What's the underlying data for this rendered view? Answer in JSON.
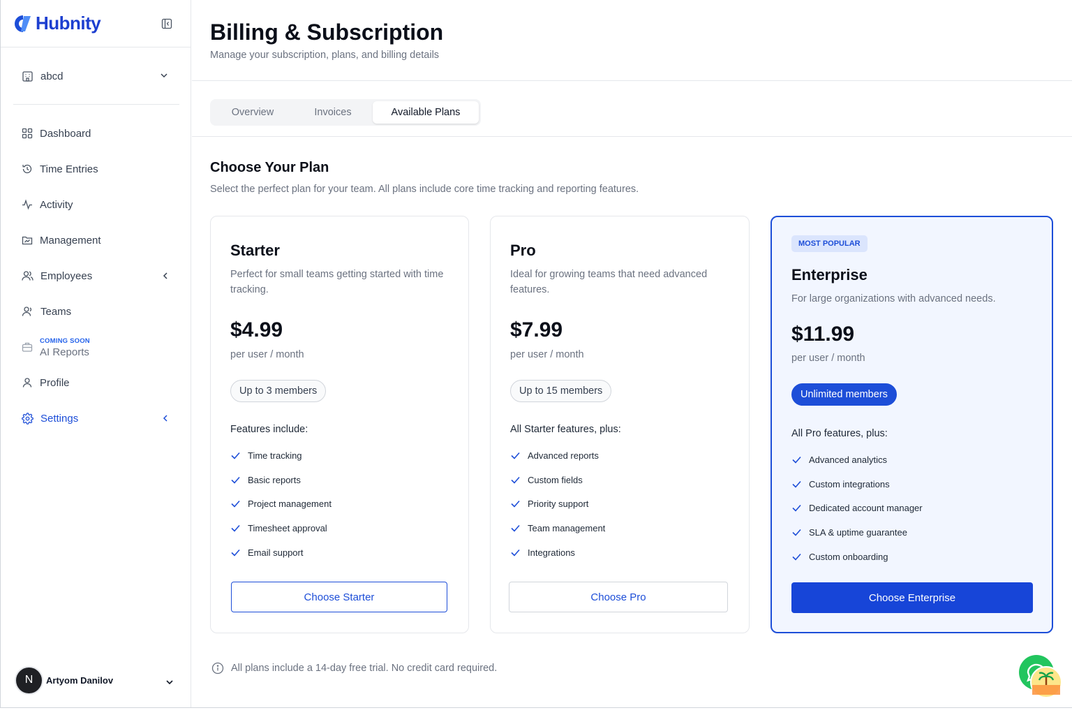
{
  "brand": {
    "name": "Hubnity",
    "accent": "#1d4ed8"
  },
  "sidebar": {
    "org": {
      "name": "abcd"
    },
    "items": [
      {
        "label": "Dashboard",
        "icon": "grid-icon"
      },
      {
        "label": "Time Entries",
        "icon": "history-icon"
      },
      {
        "label": "Activity",
        "icon": "activity-icon"
      },
      {
        "label": "Management",
        "icon": "folder-chart-icon"
      },
      {
        "label": "Employees",
        "icon": "users-icon"
      },
      {
        "label": "Teams",
        "icon": "user-group-icon"
      },
      {
        "label": "Profile",
        "icon": "user-icon"
      },
      {
        "label": "Settings",
        "icon": "gear-icon"
      }
    ],
    "ai_reports": {
      "badge": "COMING SOON",
      "label": "AI Reports"
    },
    "user": {
      "initial": "N",
      "name": "Artyom Danilov"
    }
  },
  "header": {
    "title": "Billing & Subscription",
    "subtitle": "Manage your subscription, plans, and billing details"
  },
  "tabs": [
    {
      "label": "Overview"
    },
    {
      "label": "Invoices"
    },
    {
      "label": "Available Plans"
    }
  ],
  "section": {
    "title": "Choose Your Plan",
    "description": "Select the perfect plan for your team. All plans include core time tracking and reporting features."
  },
  "plans": [
    {
      "name": "Starter",
      "description": "Perfect for small teams getting started with time tracking.",
      "price": "$4.99",
      "period": "per user / month",
      "members": "Up to 3 members",
      "features_heading": "Features include:",
      "features": [
        "Time tracking",
        "Basic reports",
        "Project management",
        "Timesheet approval",
        "Email support"
      ],
      "cta": "Choose Starter"
    },
    {
      "name": "Pro",
      "description": "Ideal for growing teams that need advanced features.",
      "price": "$7.99",
      "period": "per user / month",
      "members": "Up to 15 members",
      "features_heading": "All Starter features, plus:",
      "features": [
        "Advanced reports",
        "Custom fields",
        "Priority support",
        "Team management",
        "Integrations"
      ],
      "cta": "Choose Pro"
    },
    {
      "badge": "MOST POPULAR",
      "name": "Enterprise",
      "description": "For large organizations with advanced needs.",
      "price": "$11.99",
      "period": "per user / month",
      "members": "Unlimited members",
      "features_heading": "All Pro features, plus:",
      "features": [
        "Advanced analytics",
        "Custom integrations",
        "Dedicated account manager",
        "SLA & uptime guarantee",
        "Custom onboarding"
      ],
      "cta": "Choose Enterprise"
    }
  ],
  "footnote": "All plans include a 14-day free trial. No credit card required.",
  "chat": {
    "icon": "chat-icon"
  }
}
